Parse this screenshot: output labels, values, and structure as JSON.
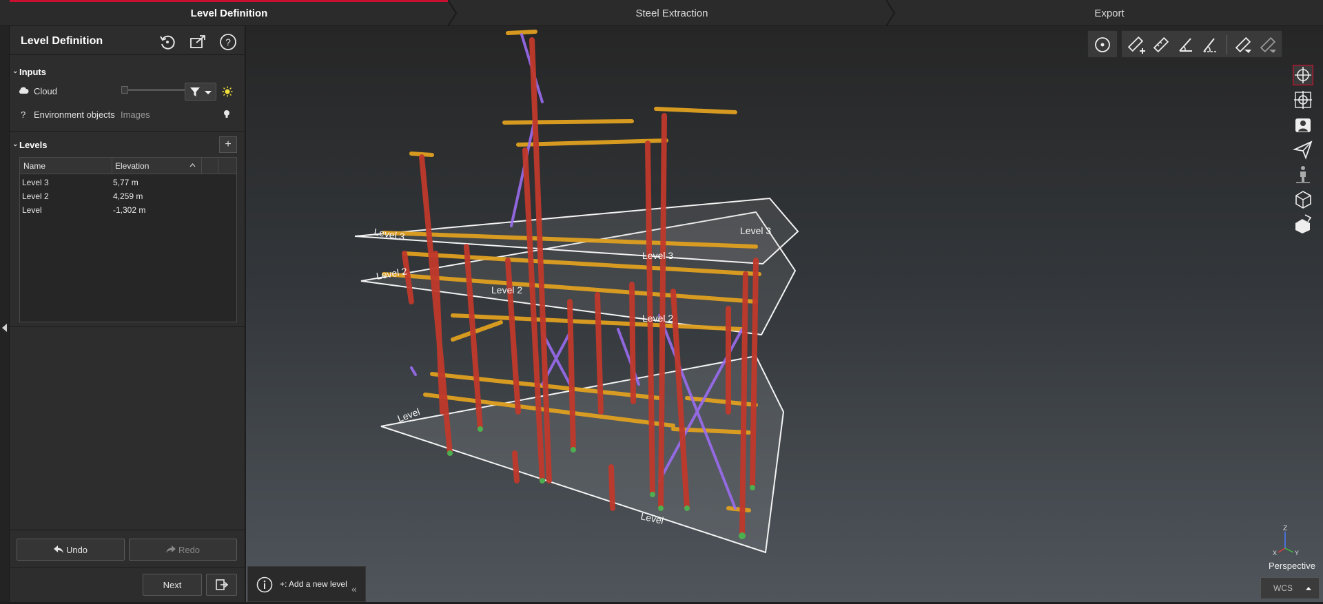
{
  "workflow": {
    "steps": [
      "Level Definition",
      "Steel Extraction",
      "Export"
    ],
    "active_step": "Level Definition"
  },
  "panel": {
    "title": "Level Definition",
    "header_icons": [
      "reset-icon",
      "export-icon",
      "help-icon"
    ],
    "inputs": {
      "section_label": "Inputs",
      "cloud_label": "Cloud",
      "environment_label": "Environment objects",
      "environment_value": "Images"
    },
    "levels": {
      "section_label": "Levels",
      "add_label": "+",
      "columns": [
        "Name",
        "Elevation"
      ],
      "rows": [
        {
          "name": "Level 3",
          "elevation": "5,77 m"
        },
        {
          "name": "Level 2",
          "elevation": "4,259 m"
        },
        {
          "name": "Level",
          "elevation": "-1,302 m"
        }
      ]
    },
    "undo_label": "Undo",
    "redo_label": "Redo",
    "next_label": "Next"
  },
  "viewport": {
    "hint_text": "+: Add a new level",
    "projection_label": "Perspective",
    "coord_system": "WCS",
    "axis_labels": {
      "z": "Z",
      "x": "X",
      "y": "Y"
    },
    "plane_labels": [
      "Level 3",
      "Level 3",
      "Level 2",
      "Level 2",
      "Level",
      "Level"
    ],
    "toolbar_icons": [
      "target-icon",
      "add-measure-icon",
      "measure-icon",
      "angle-measure-icon",
      "slope-measure-icon",
      "clear-measure-icon",
      "remove-measure-icon"
    ],
    "nav_icons": [
      "orbit-icon",
      "pan-icon",
      "walk-icon",
      "fly-icon",
      "person-icon",
      "box-view-icon",
      "section-box-icon"
    ]
  },
  "colors": {
    "accent": "#c8102e",
    "column": "#c0392b",
    "beam": "#e0a020",
    "brace": "#9b6cf0",
    "base": "#4caf50"
  }
}
